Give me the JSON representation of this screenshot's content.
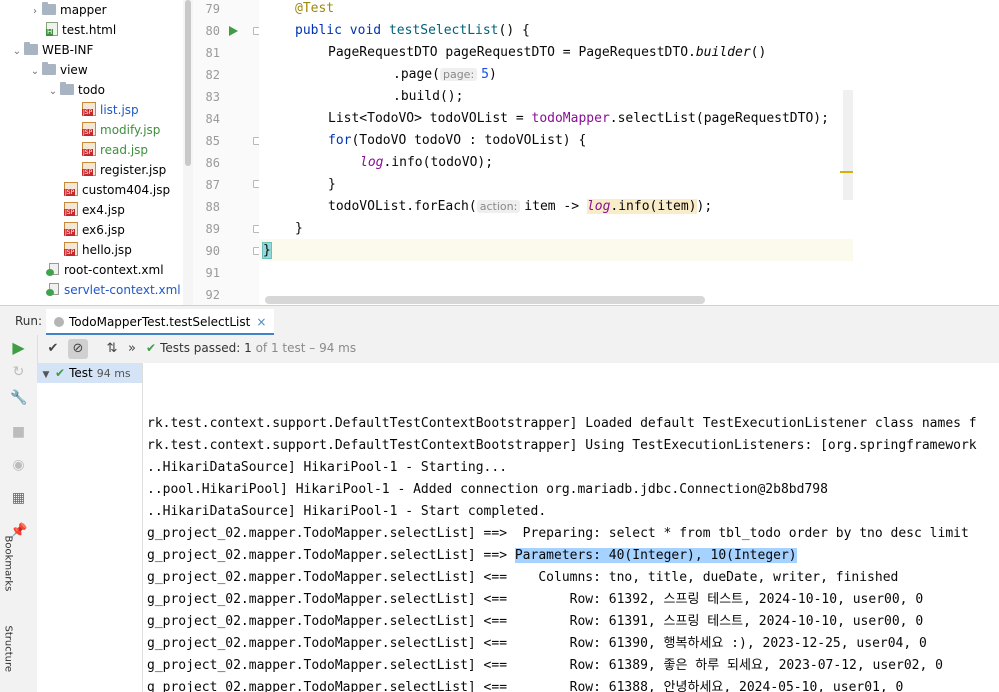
{
  "project_tree": [
    {
      "label": "mapper",
      "type": "folder",
      "arrow": "›",
      "style": ""
    },
    {
      "label": "test.html",
      "type": "html",
      "arrow": "",
      "style": ""
    },
    {
      "label": "WEB-INF",
      "type": "folder",
      "arrow": "⌄",
      "style": ""
    },
    {
      "label": "view",
      "type": "folder",
      "arrow": "⌄",
      "style": ""
    },
    {
      "label": "todo",
      "type": "folder",
      "arrow": "⌄",
      "style": ""
    },
    {
      "label": "list.jsp",
      "type": "jsp",
      "arrow": "",
      "style": "blue"
    },
    {
      "label": "modify.jsp",
      "type": "jsp",
      "arrow": "",
      "style": "green"
    },
    {
      "label": "read.jsp",
      "type": "jsp",
      "arrow": "",
      "style": "green"
    },
    {
      "label": "register.jsp",
      "type": "jsp",
      "arrow": "",
      "style": ""
    },
    {
      "label": "custom404.jsp",
      "type": "jsp",
      "arrow": "",
      "style": ""
    },
    {
      "label": "ex4.jsp",
      "type": "jsp",
      "arrow": "",
      "style": ""
    },
    {
      "label": "ex6.jsp",
      "type": "jsp",
      "arrow": "",
      "style": ""
    },
    {
      "label": "hello.jsp",
      "type": "jsp",
      "arrow": "",
      "style": ""
    },
    {
      "label": "root-context.xml",
      "type": "xml",
      "arrow": "",
      "style": ""
    },
    {
      "label": "servlet-context.xml",
      "type": "xml",
      "arrow": "",
      "style": "blue"
    }
  ],
  "editor": {
    "line_numbers": [
      "79",
      "80",
      "81",
      "82",
      "83",
      "84",
      "85",
      "86",
      "87",
      "88",
      "89",
      "90",
      "91",
      "92"
    ],
    "code": {
      "l79_annotation": "@Test",
      "l80_kw1": "public",
      "l80_kw2": "void",
      "l80_method": "testSelectList",
      "l80_rest": "() {",
      "l81_a": "PageRequestDTO pageRequestDTO = PageRequestDTO.",
      "l81_b": "builder",
      "l81_c": "()",
      "l82_a": ".page(",
      "l82_hint": "page:",
      "l82_num": "5",
      "l82_b": ")",
      "l83": ".build();",
      "l84_a": "List<TodoVO> todoVOList = ",
      "l84_field": "todoMapper",
      "l84_b": ".selectList(pageRequestDTO);",
      "l85_kw": "for",
      "l85_rest": "(TodoVO todoVO : todoVOList) {",
      "l86_log": "log",
      "l86_rest": ".info(todoVO);",
      "l87": "}",
      "l88_a": "todoVOList.forEach(",
      "l88_hint": "action:",
      "l88_b": "item -> ",
      "l88_log": "log",
      "l88_c": ".info(item)",
      "l88_d": ");",
      "l89": "}",
      "l90": "}"
    }
  },
  "run_panel": {
    "label": "Run:",
    "tab_title": "TodoMapperTest.testSelectList",
    "tab_close": "×",
    "status": {
      "prefix": "Tests passed:",
      "passed": "1",
      "of_total": "of 1 test – 94 ms"
    },
    "test_tree": {
      "name": "Test",
      "time": "94 ms"
    },
    "side_label": "Bookmarks",
    "side_label2": "Structure"
  },
  "console_lines": [
    {
      "text": "",
      "sel": ""
    },
    {
      "text": "",
      "sel": ""
    },
    {
      "text": "rk.test.context.support.DefaultTestContextBootstrapper] Loaded default TestExecutionListener class names f",
      "sel": ""
    },
    {
      "text": "rk.test.context.support.DefaultTestContextBootstrapper] Using TestExecutionListeners: [org.springframework",
      "sel": ""
    },
    {
      "text": "..HikariDataSource] HikariPool-1 - Starting...",
      "sel": ""
    },
    {
      "text": "..pool.HikariPool] HikariPool-1 - Added connection org.mariadb.jdbc.Connection@2b8bd798",
      "sel": ""
    },
    {
      "text": "..HikariDataSource] HikariPool-1 - Start completed.",
      "sel": ""
    },
    {
      "text": "g_project_02.mapper.TodoMapper.selectList] ==>  Preparing: select * from tbl_todo order by tno desc limit",
      "sel": ""
    },
    {
      "text": "g_project_02.mapper.TodoMapper.selectList] ==> ",
      "sel": "Parameters: 40(Integer), 10(Integer)"
    },
    {
      "text": "g_project_02.mapper.TodoMapper.selectList] <==    Columns: tno, title, dueDate, writer, finished",
      "sel": ""
    },
    {
      "text": "g_project_02.mapper.TodoMapper.selectList] <==        Row: 61392, 스프링 테스트, 2024-10-10, user00, 0",
      "sel": ""
    },
    {
      "text": "g_project_02.mapper.TodoMapper.selectList] <==        Row: 61391, 스프링 테스트, 2024-10-10, user00, 0",
      "sel": ""
    },
    {
      "text": "g_project_02.mapper.TodoMapper.selectList] <==        Row: 61390, 행복하세요 :), 2023-12-25, user04, 0",
      "sel": ""
    },
    {
      "text": "g_project_02.mapper.TodoMapper.selectList] <==        Row: 61389, 좋은 하루 되세요, 2023-07-12, user02, 0",
      "sel": ""
    },
    {
      "text": "g_project_02.mapper.TodoMapper.selectList] <==        Row: 61388, 안녕하세요, 2024-05-10, user01, 0",
      "sel": ""
    }
  ]
}
